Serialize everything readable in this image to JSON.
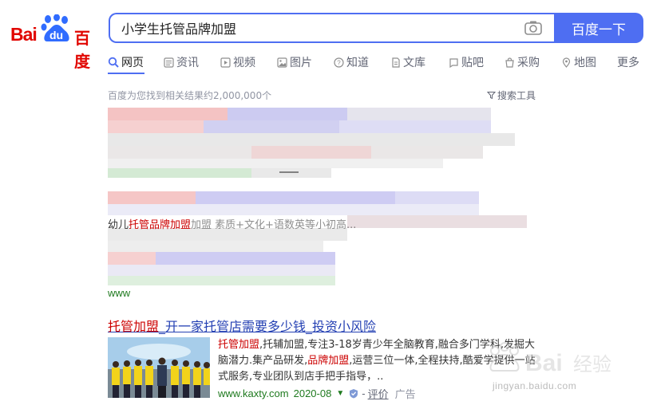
{
  "logo": {
    "part_latin": "Bai",
    "part_du": "du",
    "part_cn": "百度"
  },
  "search": {
    "query": "小学生托管品牌加盟",
    "button_label": "百度一下"
  },
  "tabs": [
    {
      "label": "网页",
      "icon": "search-icon",
      "active": true
    },
    {
      "label": "资讯",
      "icon": "news-icon"
    },
    {
      "label": "视频",
      "icon": "video-icon"
    },
    {
      "label": "图片",
      "icon": "image-icon"
    },
    {
      "label": "知道",
      "icon": "question-icon"
    },
    {
      "label": "文库",
      "icon": "document-icon"
    },
    {
      "label": "贴吧",
      "icon": "tieba-icon"
    },
    {
      "label": "采购",
      "icon": "purchase-icon"
    },
    {
      "label": "地图",
      "icon": "map-icon"
    },
    {
      "label": "更多",
      "icon": ""
    }
  ],
  "result_count": "百度为您找到相关结果约2,000,000个",
  "search_tools": "搜索工具",
  "blurred_snippet": {
    "prefix": "幼儿",
    "highlight": "托管品牌加盟",
    "suffix": "加盟 素质+文化+语数英等小初高..."
  },
  "blurred_url_fragment": "www",
  "ad": {
    "title_highlight": "托管加盟",
    "title_rest": "_开一家托管店需要多少钱_投资小风险",
    "desc_parts": [
      {
        "text": "托管加盟",
        "hl": true
      },
      {
        "text": ",托辅加盟,专注3-18岁青少年全脑教育,融合多门学科,发掘大脑潜力.集产品研发,",
        "hl": false
      },
      {
        "text": "品牌加盟",
        "hl": true
      },
      {
        "text": ",运营三位一体,全程扶持,酷爱学提供一站式服务,专业团队到店手把手指导，..",
        "hl": false
      }
    ],
    "url": "www.kaxty.com",
    "date": "2020-08",
    "review_label": "评价",
    "ad_label": "广告",
    "dash": "-"
  },
  "watermark": {
    "text": "jingyan.baidu.com"
  },
  "colors": {
    "brand_blue": "#4e6ef2",
    "brand_red": "#e10601",
    "link_blue": "#2440b3",
    "url_green": "#1f7a1f",
    "highlight_red": "#cc0000"
  }
}
